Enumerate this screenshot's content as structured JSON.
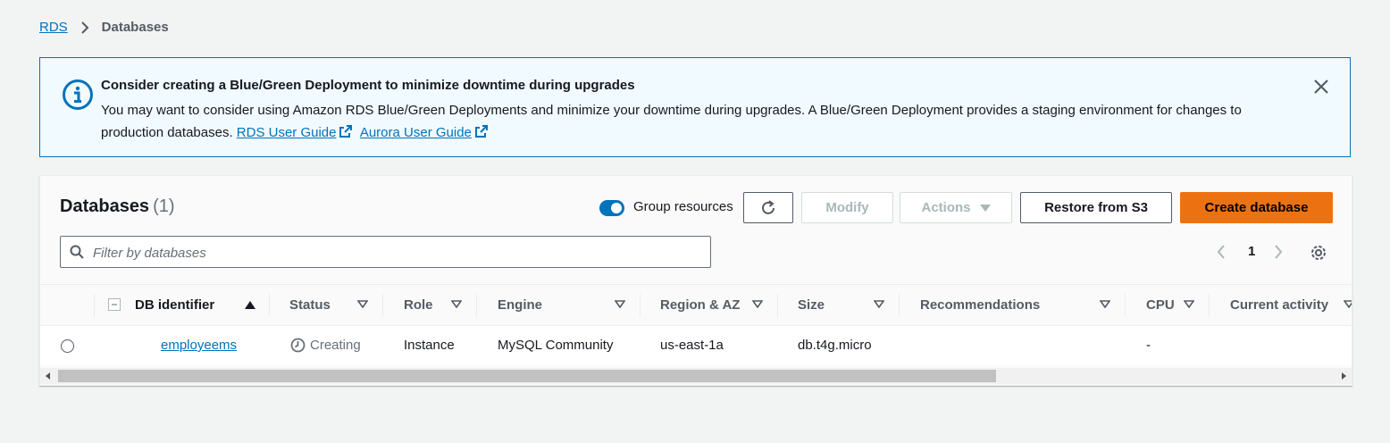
{
  "breadcrumb": {
    "root": "RDS",
    "current": "Databases"
  },
  "flash": {
    "title": "Consider creating a Blue/Green Deployment to minimize downtime during upgrades",
    "body": "You may want to consider using Amazon RDS Blue/Green Deployments and minimize your downtime during upgrades. A Blue/Green Deployment provides a staging environment for changes to production databases.",
    "link1": "RDS User Guide",
    "link2": "Aurora User Guide",
    "icon": "info-icon",
    "accent": "#0073bb"
  },
  "panel": {
    "title": "Databases",
    "count": "(1)",
    "group_label": "Group resources",
    "buttons": {
      "modify": "Modify",
      "actions": "Actions",
      "restore": "Restore from S3",
      "create": "Create database"
    },
    "search": {
      "placeholder": "Filter by databases",
      "value": ""
    },
    "pagination": {
      "page": "1"
    }
  },
  "table": {
    "columns": [
      "DB identifier",
      "Status",
      "Role",
      "Engine",
      "Region & AZ",
      "Size",
      "Recommendations",
      "CPU",
      "Current activity"
    ],
    "rows": [
      {
        "identifier": "employeems",
        "status": "Creating",
        "role": "Instance",
        "engine": "MySQL Community",
        "region": "us-east-1a",
        "size": "db.t4g.micro",
        "recommendations": "",
        "cpu": "-",
        "activity": ""
      }
    ]
  },
  "colors": {
    "link": "#0073bb",
    "primary": "#ec7211",
    "background": "#f2f3f3"
  }
}
